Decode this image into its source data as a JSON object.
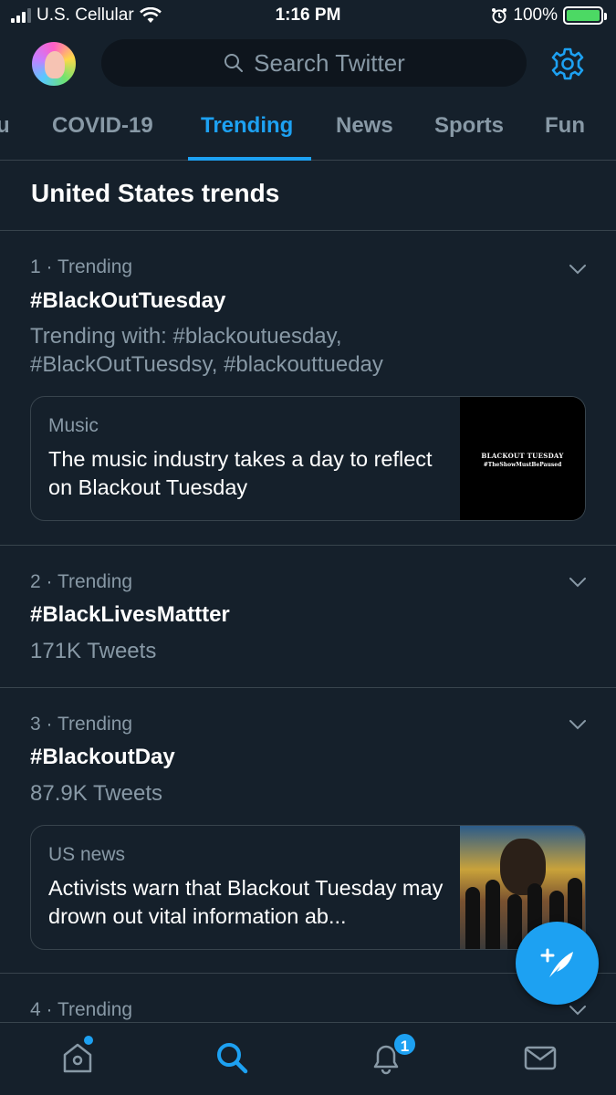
{
  "status_bar": {
    "carrier": "U.S. Cellular",
    "time": "1:16 PM",
    "battery": "100%"
  },
  "header": {
    "search_placeholder": "Search Twitter"
  },
  "tabs": [
    {
      "label": "u"
    },
    {
      "label": "COVID-19"
    },
    {
      "label": "Trending",
      "active": true
    },
    {
      "label": "News"
    },
    {
      "label": "Sports"
    },
    {
      "label": "Fun"
    }
  ],
  "section_title": "United States trends",
  "trends": [
    {
      "meta": "1 · Trending",
      "name": "#BlackOutTuesday",
      "sub_line1": "Trending with: #blackoutuesday,",
      "sub_line2": "#BlackOutTuesdsy, #blackouttueday",
      "card": {
        "category": "Music",
        "headline": "The music industry takes a day to reflect on Blackout Tuesday",
        "thumb_line1": "BLACKOUT TUESDAY",
        "thumb_line2": "#TheShowMustBePaused"
      }
    },
    {
      "meta": "2 · Trending",
      "name": "#BlackLivesMattter",
      "sub": "171K Tweets"
    },
    {
      "meta": "3 · Trending",
      "name": "#BlackoutDay",
      "sub": "87.9K Tweets",
      "card": {
        "category": "US news",
        "headline": "Activists warn that Blackout Tuesday may drown out vital information ab..."
      }
    },
    {
      "meta": "4 · Trending"
    }
  ],
  "bottom_nav": {
    "notifications_badge": "1"
  },
  "colors": {
    "background": "#15202b",
    "accent": "#1da1f2",
    "muted_text": "#8899a6",
    "divider": "#38444d"
  }
}
